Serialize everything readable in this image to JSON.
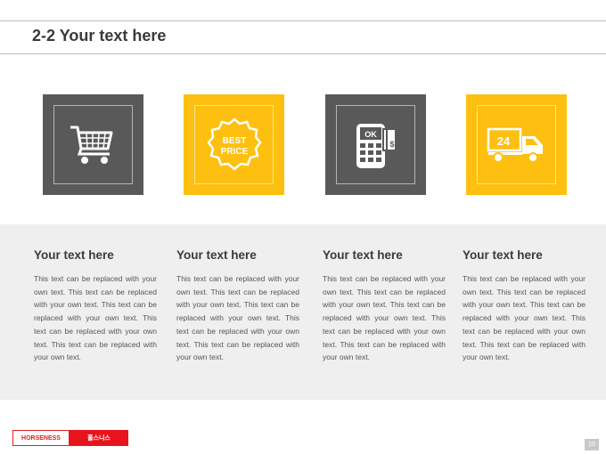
{
  "page": {
    "title": "2-2 Your text here",
    "page_number": "10"
  },
  "tiles": [
    {
      "icon": "shopping-cart-icon",
      "color": "#595959"
    },
    {
      "icon": "best-price-badge-icon",
      "color": "#fdc010",
      "badge_line1": "BEST",
      "badge_line2": "PRICE"
    },
    {
      "icon": "card-terminal-icon",
      "color": "#595959",
      "screen_text": "OK",
      "card_text": "$"
    },
    {
      "icon": "delivery-truck-icon",
      "color": "#fdc010",
      "truck_text": "24"
    }
  ],
  "columns": [
    {
      "heading": "Your text here",
      "body": "This text can be replaced with your own text. This text can be replaced with your own text. This text can be replaced with your own text. This text can be replaced with your own text. This text can be replaced with your own text."
    },
    {
      "heading": "Your text here",
      "body": "This text can be replaced with your own text. This text can be replaced with your own text. This text can be replaced with your own text. This text can be replaced with your own text. This text can be replaced with your own text."
    },
    {
      "heading": "Your text here",
      "body": "This text can be replaced with your own text. This text can be replaced with your own text. This text can be replaced with your own text. This text can be replaced with your own text. This text can be replaced with your own text."
    },
    {
      "heading": "Your text here",
      "body": "This text can be replaced with your own text. This text can be replaced with your own text. This text can be replaced with your own text. This text can be replaced with your own text. This text can be replaced with your own text."
    }
  ],
  "footer": {
    "logo_left": "HORSENESS",
    "logo_right": "홀스니스"
  }
}
